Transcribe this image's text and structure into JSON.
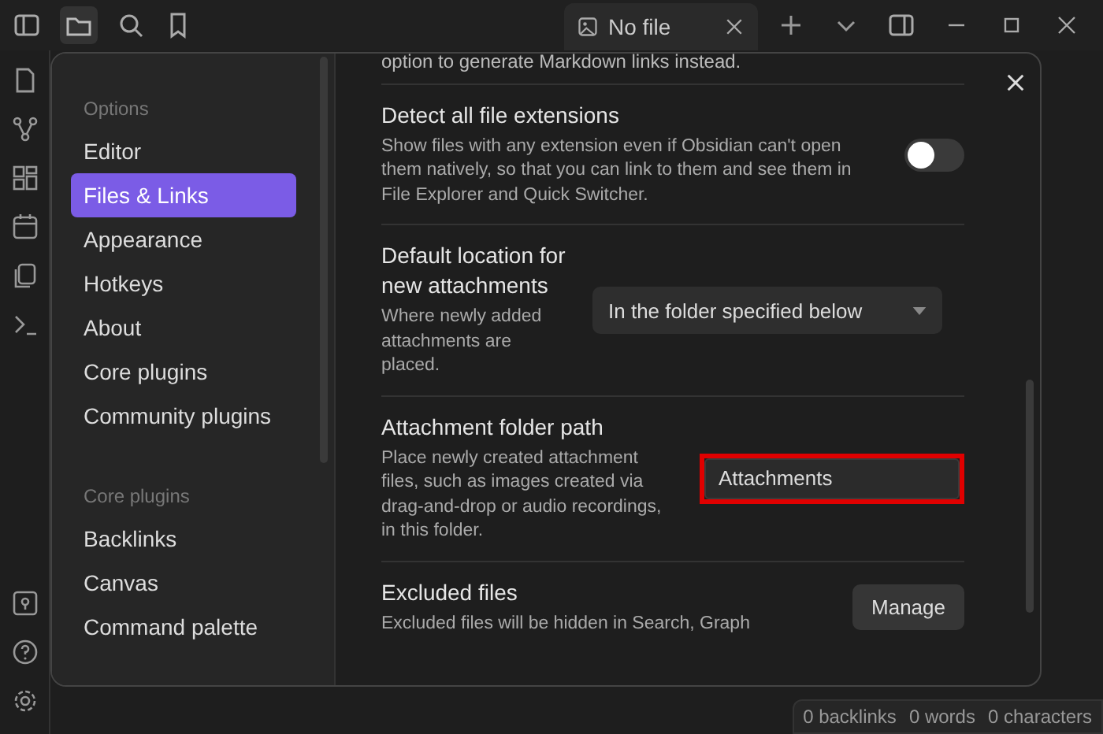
{
  "tab": {
    "title": "No file"
  },
  "sidebar": [
    {
      "heading": "Options",
      "items": [
        {
          "label": "Editor",
          "selected": false
        },
        {
          "label": "Files & Links",
          "selected": true
        },
        {
          "label": "Appearance",
          "selected": false
        },
        {
          "label": "Hotkeys",
          "selected": false
        },
        {
          "label": "About",
          "selected": false
        },
        {
          "label": "Core plugins",
          "selected": false
        },
        {
          "label": "Community plugins",
          "selected": false
        }
      ]
    },
    {
      "heading": "Core plugins",
      "items": [
        {
          "label": "Backlinks",
          "selected": false
        },
        {
          "label": "Canvas",
          "selected": false
        },
        {
          "label": "Command palette",
          "selected": false
        }
      ]
    }
  ],
  "settings_intro": "option to generate Markdown links instead.",
  "settings": [
    {
      "kind": "toggle",
      "name": "Detect all file extensions",
      "description": "Show files with any extension even if Obsidian can't open them natively, so that you can link to them and see them in File Explorer and Quick Switcher.",
      "on": false
    },
    {
      "kind": "dropdown",
      "name": "Default location for new attachments",
      "description": "Where newly added attachments are placed.",
      "value": "In the folder specified below"
    },
    {
      "kind": "text",
      "name": "Attachment folder path",
      "description": "Place newly created attachment files, such as images created via drag-and-drop or audio recordings, in this folder.",
      "value": "Attachments",
      "highlighted": true
    },
    {
      "kind": "button",
      "name": "Excluded files",
      "description": "Excluded files will be hidden in Search, Graph",
      "value": "Manage"
    }
  ],
  "status_bar": [
    "0 backlinks",
    "0 words",
    "0 characters"
  ]
}
